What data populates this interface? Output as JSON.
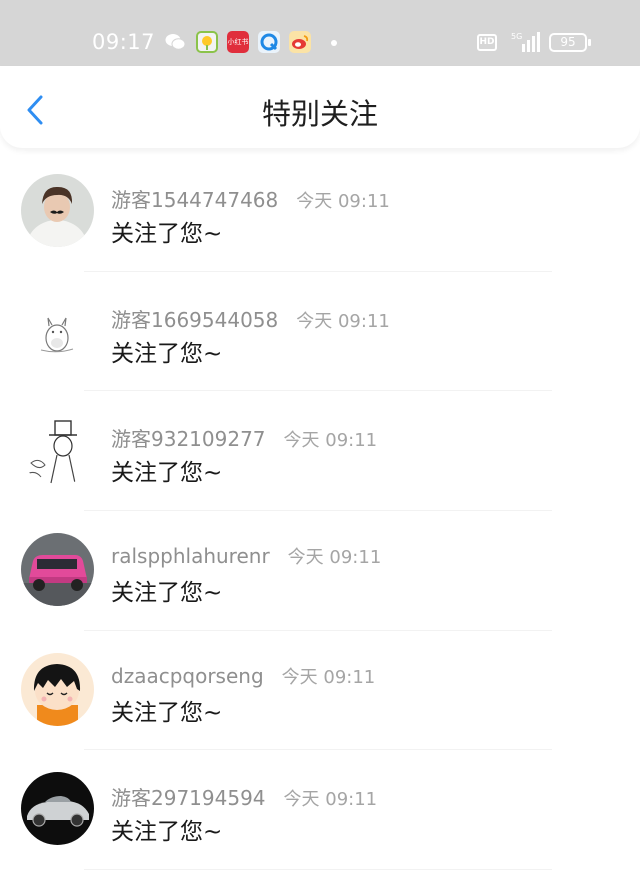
{
  "status_bar": {
    "time": "09:17",
    "icons": [
      "wechat-icon",
      "app-icon",
      "xiaohongshu-icon",
      "browser-icon",
      "weibo-icon"
    ],
    "app2_label": "小红书",
    "hd_label": "HD",
    "network": "5G",
    "battery": "95"
  },
  "nav": {
    "title": "特别关注",
    "back_icon": "chevron-left-icon",
    "accent": "#2f8ef2"
  },
  "items": [
    {
      "name": "游客1544747468",
      "time": "今天 09:11",
      "message": "关注了您~",
      "avatar": "boy-photo"
    },
    {
      "name": "游客1669544058",
      "time": "今天 09:11",
      "message": "关注了您~",
      "avatar": "totoro-sketch"
    },
    {
      "name": "游客932109277",
      "time": "今天 09:11",
      "message": "关注了您~",
      "avatar": "kid-sketch"
    },
    {
      "name": "ralspphlahurenr",
      "time": "今天 09:11",
      "message": "关注了您~",
      "avatar": "pink-car"
    },
    {
      "name": "dzaacpqorseng",
      "time": "今天 09:11",
      "message": "关注了您~",
      "avatar": "maruko-cartoon"
    },
    {
      "name": "游客297194594",
      "time": "今天 09:11",
      "message": "关注了您~",
      "avatar": "silver-car"
    }
  ]
}
